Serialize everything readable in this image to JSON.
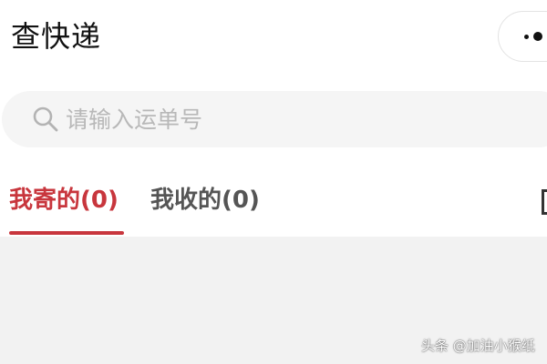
{
  "header": {
    "title": "查快递",
    "menu_capsule_icon": "more-dots-icon"
  },
  "search": {
    "icon": "search-icon",
    "placeholder": "请输入运单号",
    "value": ""
  },
  "tabs": [
    {
      "label": "我寄的(0)",
      "count": 0,
      "active": true
    },
    {
      "label": "我收的(0)",
      "count": 0,
      "active": false
    }
  ],
  "colors": {
    "accent": "#c8363d",
    "tab_inactive": "#555555",
    "page_background": "#f2f2f2",
    "surface": "#ffffff",
    "search_background": "#f5f5f5",
    "placeholder": "#b8b8b8"
  },
  "watermark": {
    "text": "头条 @加油小猴纸"
  }
}
